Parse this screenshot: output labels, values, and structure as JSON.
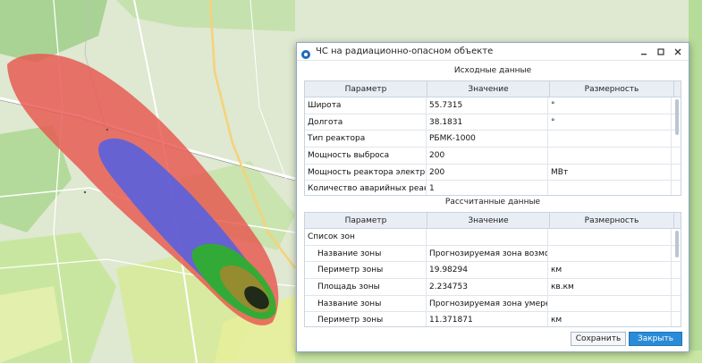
{
  "dialog": {
    "title": "ЧС на радиационно-опасном объекте",
    "icon": "app-icon",
    "controls": [
      "minimize-icon",
      "maximize-icon",
      "close-icon"
    ]
  },
  "input_section": {
    "title": "Исходные данные",
    "headers": [
      "Параметр",
      "Значение",
      "Размерность"
    ],
    "rows": [
      {
        "param": "Широта",
        "value": "55.7315",
        "unit": "°"
      },
      {
        "param": "Долгота",
        "value": "38.1831",
        "unit": "°"
      },
      {
        "param": "Тип реактора",
        "value": "РБМК-1000",
        "unit": ""
      },
      {
        "param": "Мощность выброса",
        "value": "200",
        "unit": ""
      },
      {
        "param": "Мощность реактора электрическая",
        "value": "200",
        "unit": "МВт"
      },
      {
        "param": "Количество аварийных реакторов",
        "value": "1",
        "unit": ""
      }
    ]
  },
  "calc_section": {
    "title": "Рассчитанные данные",
    "headers": [
      "Параметр",
      "Значение",
      "Размерность"
    ],
    "rows": [
      {
        "param": "Список зон",
        "value": "",
        "unit": "",
        "indent": false
      },
      {
        "param": "Название зоны",
        "value": "Прогнозируемая зона возможног...",
        "unit": "",
        "indent": true
      },
      {
        "param": "Периметр зоны",
        "value": "19.98294",
        "unit": "км",
        "indent": true
      },
      {
        "param": "Площадь зоны",
        "value": "2.234753",
        "unit": "кв.км",
        "indent": true
      },
      {
        "param": "Название зоны",
        "value": "Прогнозируемая зона умеренного...",
        "unit": "",
        "indent": true
      },
      {
        "param": "Периметр зоны",
        "value": "11.371871",
        "unit": "км",
        "indent": true
      }
    ]
  },
  "buttons": {
    "save": "Сохранить",
    "close": "Закрыть"
  },
  "colors": {
    "accent": "#2a8bd8",
    "zone_red": "#e8574f",
    "zone_blue": "#5560e0",
    "zone_green": "#2fae2f",
    "zone_dark": "#1f2a18"
  }
}
